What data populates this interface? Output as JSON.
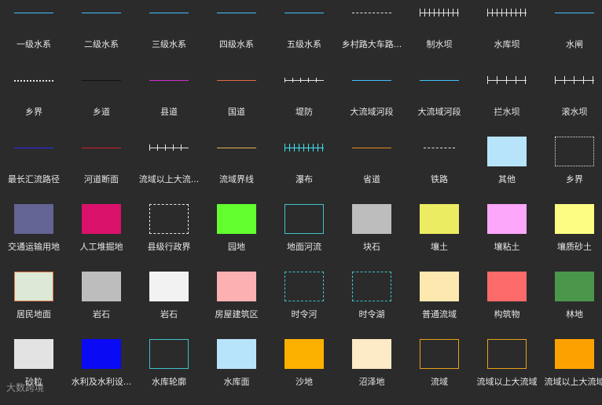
{
  "legend": {
    "items": [
      {
        "label": "一级水系",
        "kind": "line",
        "style": "solid",
        "color": "#3fc3ff"
      },
      {
        "label": "二级水系",
        "kind": "line",
        "style": "solid",
        "color": "#3fc3ff"
      },
      {
        "label": "三级水系",
        "kind": "line",
        "style": "solid",
        "color": "#3fc3ff"
      },
      {
        "label": "四级水系",
        "kind": "line",
        "style": "solid",
        "color": "#3fc3ff"
      },
      {
        "label": "五级水系",
        "kind": "line",
        "style": "solid",
        "color": "#3fc3ff"
      },
      {
        "label": "乡村路大车路...",
        "kind": "line",
        "style": "dash",
        "color": "#e6e6e6"
      },
      {
        "label": "制水坝",
        "kind": "line",
        "style": "tick",
        "color": "#e6e6e6"
      },
      {
        "label": "水库坝",
        "kind": "line",
        "style": "tick",
        "color": "#e6e6e6"
      },
      {
        "label": "水闸",
        "kind": "line",
        "style": "solid",
        "color": "#3fc3ff"
      },
      {
        "label": "乡界",
        "kind": "line",
        "style": "dots",
        "color": "#e6e6e6"
      },
      {
        "label": "乡道",
        "kind": "line",
        "style": "solid",
        "color": "#111111"
      },
      {
        "label": "县道",
        "kind": "line",
        "style": "solid",
        "color": "#d02fd0"
      },
      {
        "label": "国道",
        "kind": "line",
        "style": "solid",
        "color": "#e06a42"
      },
      {
        "label": "堤防",
        "kind": "line",
        "style": "tick-half",
        "color": "#e6e6e6"
      },
      {
        "label": "大流域河段",
        "kind": "line",
        "style": "solid",
        "color": "#3fc3ff"
      },
      {
        "label": "大流域河段",
        "kind": "line",
        "style": "solid",
        "color": "#3fc3ff"
      },
      {
        "label": "拦水坝",
        "kind": "line",
        "style": "tick-sparse",
        "color": "#e6e6e6"
      },
      {
        "label": "滚水坝",
        "kind": "line",
        "style": "tick-sparse",
        "color": "#e6e6e6"
      },
      {
        "label": "最长汇流路径",
        "kind": "line",
        "style": "solid",
        "color": "#2a2aff"
      },
      {
        "label": "河道断面",
        "kind": "line",
        "style": "solid",
        "color": "#d01f2f"
      },
      {
        "label": "流域以上大流...",
        "kind": "line",
        "style": "mixed",
        "color": "#e6e6e6"
      },
      {
        "label": "流域界线",
        "kind": "line",
        "style": "solid",
        "color": "#e7b05a"
      },
      {
        "label": "瀑布",
        "kind": "line",
        "style": "tick",
        "color": "#3fe6f0"
      },
      {
        "label": "省道",
        "kind": "line",
        "style": "solid",
        "color": "#e68a1e"
      },
      {
        "label": "铁路",
        "kind": "line",
        "style": "gap",
        "color": "#e6e6e6"
      },
      {
        "label": "其他",
        "kind": "area",
        "fill": "#b7e4fb",
        "border": "#b7e4fb",
        "border_style": "solid"
      },
      {
        "label": "乡界",
        "kind": "area",
        "fill": "transparent",
        "border": "#e6e6e6",
        "border_style": "dotted"
      },
      {
        "label": "交通运输用地",
        "kind": "area",
        "fill": "#636394",
        "border": "#636394",
        "border_style": "solid"
      },
      {
        "label": "人工堆掘地",
        "kind": "area",
        "fill": "#d9116b",
        "border": "#d9116b",
        "border_style": "solid"
      },
      {
        "label": "县级行政界",
        "kind": "area",
        "fill": "transparent",
        "border": "#e6e6e6",
        "border_style": "dashed"
      },
      {
        "label": "园地",
        "kind": "area",
        "fill": "#63ff2f",
        "border": "#63ff2f",
        "border_style": "solid"
      },
      {
        "label": "地面河流",
        "kind": "area",
        "fill": "transparent",
        "border": "#3fc3c8",
        "border_style": "solid"
      },
      {
        "label": "块石",
        "kind": "area",
        "fill": "#bdbdbd",
        "border": "#bdbdbd",
        "border_style": "solid"
      },
      {
        "label": "壤土",
        "kind": "area",
        "fill": "#ecec63",
        "border": "#ecec63",
        "border_style": "solid"
      },
      {
        "label": "壤粘土",
        "kind": "area",
        "fill": "#fca7fa",
        "border": "#fca7fa",
        "border_style": "solid"
      },
      {
        "label": "壤质砂土",
        "kind": "area",
        "fill": "#fdfd84",
        "border": "#fdfd84",
        "border_style": "solid"
      },
      {
        "label": "居民地面",
        "kind": "area",
        "fill": "#dbe9d6",
        "border": "#e0754b",
        "border_style": "solid"
      },
      {
        "label": "岩石",
        "kind": "area",
        "fill": "#bdbdbd",
        "border": "#bdbdbd",
        "border_style": "solid"
      },
      {
        "label": "岩石",
        "kind": "area",
        "fill": "#f2f2f2",
        "border": "#f2f2f2",
        "border_style": "solid"
      },
      {
        "label": "房屋建筑区",
        "kind": "area",
        "fill": "#fdb0b2",
        "border": "#fdb0b2",
        "border_style": "solid"
      },
      {
        "label": "时令河",
        "kind": "area",
        "fill": "transparent",
        "border": "#3fc3c8",
        "border_style": "dashed"
      },
      {
        "label": "时令湖",
        "kind": "area",
        "fill": "transparent",
        "border": "#3fc3c8",
        "border_style": "dashed"
      },
      {
        "label": "普通流域",
        "kind": "area",
        "fill": "#fde8b0",
        "border": "#fde8b0",
        "border_style": "solid"
      },
      {
        "label": "构筑物",
        "kind": "area",
        "fill": "#fc6a6a",
        "border": "#fc6a6a",
        "border_style": "solid"
      },
      {
        "label": "林地",
        "kind": "area",
        "fill": "#4a964a",
        "border": "#4a964a",
        "border_style": "solid"
      },
      {
        "label": "砂粒",
        "kind": "area",
        "fill": "#e3e3e3",
        "border": "#e3e3e3",
        "border_style": "solid"
      },
      {
        "label": "水利及水利设...",
        "kind": "area",
        "fill": "#0a0af5",
        "border": "#0a0af5",
        "border_style": "solid"
      },
      {
        "label": "水库轮廓",
        "kind": "area",
        "fill": "transparent",
        "border": "#3fc3c8",
        "border_style": "solid"
      },
      {
        "label": "水库面",
        "kind": "area",
        "fill": "#b7e4fb",
        "border": "#b7e4fb",
        "border_style": "solid"
      },
      {
        "label": "沙地",
        "kind": "area",
        "fill": "#fcb000",
        "border": "#fcb000",
        "border_style": "solid"
      },
      {
        "label": "沼泽地",
        "kind": "area",
        "fill": "#fdeac6",
        "border": "#fdeac6",
        "border_style": "solid"
      },
      {
        "label": "流域",
        "kind": "area",
        "fill": "transparent",
        "border": "#e6a21a",
        "border_style": "solid"
      },
      {
        "label": "流域以上大流域",
        "kind": "area",
        "fill": "transparent",
        "border": "#e6a21a",
        "border_style": "solid"
      },
      {
        "label": "流域以上大流域",
        "kind": "area",
        "fill": "#fca200",
        "border": "#fca200",
        "border_style": "solid"
      }
    ]
  },
  "watermark": {
    "text": "大数跨境"
  }
}
